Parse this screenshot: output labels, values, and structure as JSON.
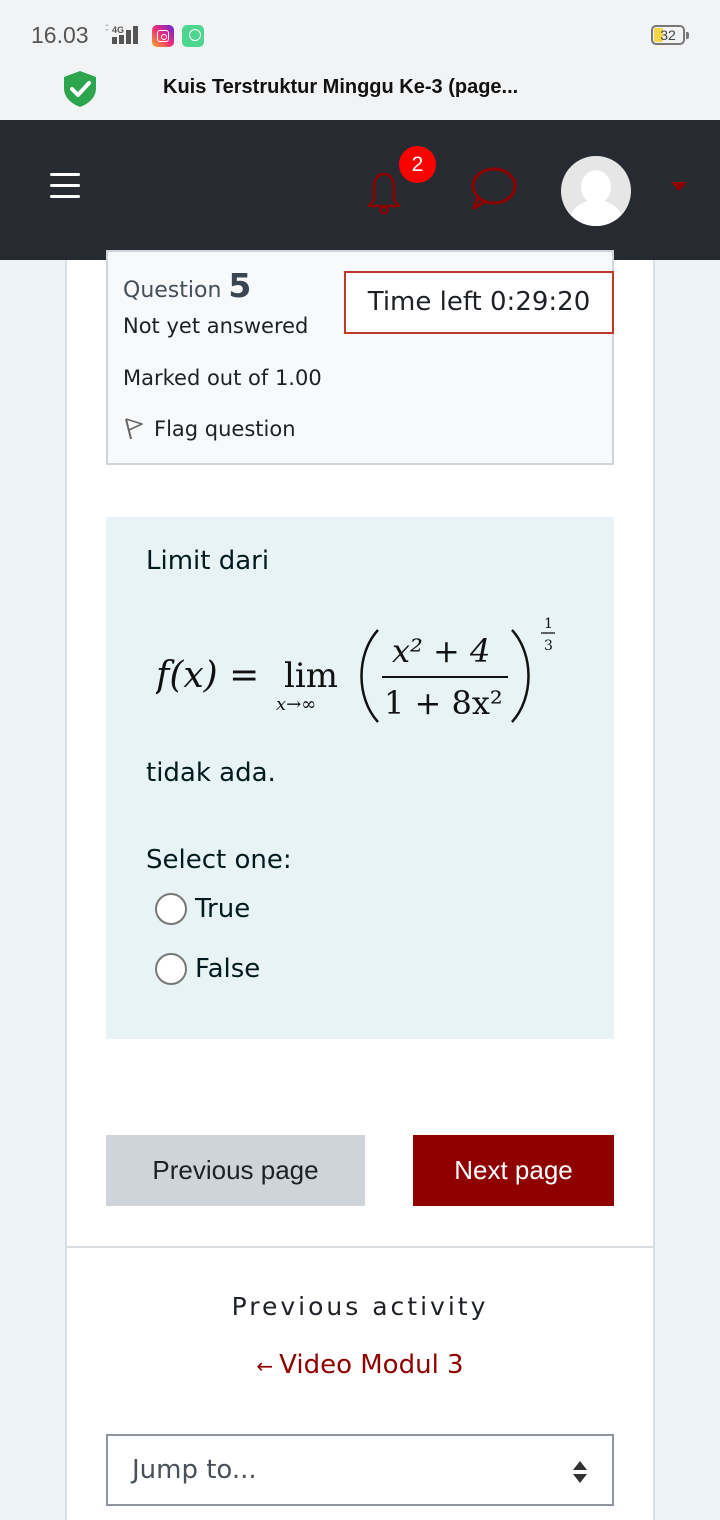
{
  "status_bar": {
    "time": "16.03",
    "network": "4G",
    "battery": "32",
    "app_icons": [
      "instagram-icon",
      "app-icon"
    ]
  },
  "browser": {
    "title": "Kuis Terstruktur Minggu Ke-3 (page...",
    "security_icon": "shield-check-icon"
  },
  "navbar": {
    "menu_icon": "hamburger-icon",
    "notification_count": "2",
    "icons": [
      "bell-icon",
      "chat-icon",
      "avatar",
      "caret-down-icon"
    ],
    "accent_color": "#8f0000"
  },
  "question": {
    "label": "Question",
    "number": "5",
    "state": "Not yet answered",
    "grade": "Marked out of 1.00",
    "flag_label": "Flag question",
    "timer": "Time left 0:29:20",
    "intro": "Limit dari",
    "formula": {
      "lhs": "f(x) =",
      "operator": "lim",
      "subscript": "x→∞",
      "numerator": "x² + 4",
      "denominator": "1 + 8x²",
      "exponent_num": "1",
      "exponent_den": "3"
    },
    "outro": "tidak ada.",
    "prompt": "Select one:",
    "options": [
      {
        "label": "True",
        "selected": false
      },
      {
        "label": "False",
        "selected": false
      }
    ]
  },
  "navigation": {
    "previous_label": "Previous page",
    "next_label": "Next page"
  },
  "activity": {
    "label": "Previous activity",
    "arrow": "←",
    "link": "Video Modul 3",
    "jump_placeholder": "Jump to..."
  }
}
